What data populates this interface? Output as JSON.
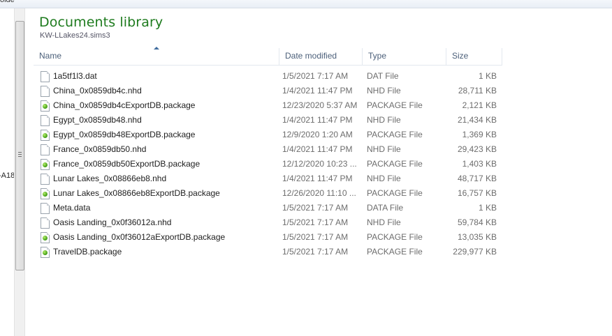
{
  "window": {
    "top_bar_text": "olde"
  },
  "left_pane": {
    "truncated_label": "-A18"
  },
  "library": {
    "title": "Documents library",
    "subtitle": "KW-LLakes24.sims3"
  },
  "columns": {
    "name": "Name",
    "date_modified": "Date modified",
    "type": "Type",
    "size": "Size"
  },
  "files": [
    {
      "name": "1a5tf1l3.dat",
      "date": "1/5/2021 7:17 AM",
      "type": "DAT File",
      "size": "1 KB",
      "icon": "file-icon"
    },
    {
      "name": "China_0x0859db4c.nhd",
      "date": "1/4/2021 11:47 PM",
      "type": "NHD File",
      "size": "28,711 KB",
      "icon": "file-icon"
    },
    {
      "name": "China_0x0859db4cExportDB.package",
      "date": "12/23/2020 5:37 AM",
      "type": "PACKAGE File",
      "size": "2,121 KB",
      "icon": "package-icon"
    },
    {
      "name": "Egypt_0x0859db48.nhd",
      "date": "1/4/2021 11:47 PM",
      "type": "NHD File",
      "size": "21,434 KB",
      "icon": "file-icon"
    },
    {
      "name": "Egypt_0x0859db48ExportDB.package",
      "date": "12/9/2020 1:20 AM",
      "type": "PACKAGE File",
      "size": "1,369 KB",
      "icon": "package-icon"
    },
    {
      "name": "France_0x0859db50.nhd",
      "date": "1/4/2021 11:47 PM",
      "type": "NHD File",
      "size": "29,423 KB",
      "icon": "file-icon"
    },
    {
      "name": "France_0x0859db50ExportDB.package",
      "date": "12/12/2020 10:23 ...",
      "type": "PACKAGE File",
      "size": "1,403 KB",
      "icon": "package-icon"
    },
    {
      "name": "Lunar Lakes_0x08866eb8.nhd",
      "date": "1/4/2021 11:47 PM",
      "type": "NHD File",
      "size": "48,717 KB",
      "icon": "file-icon"
    },
    {
      "name": "Lunar Lakes_0x08866eb8ExportDB.package",
      "date": "12/26/2020 11:10 ...",
      "type": "PACKAGE File",
      "size": "16,757 KB",
      "icon": "package-icon"
    },
    {
      "name": "Meta.data",
      "date": "1/5/2021 7:17 AM",
      "type": "DATA File",
      "size": "1 KB",
      "icon": "file-icon"
    },
    {
      "name": "Oasis Landing_0x0f36012a.nhd",
      "date": "1/5/2021 7:17 AM",
      "type": "NHD File",
      "size": "59,784 KB",
      "icon": "file-icon"
    },
    {
      "name": "Oasis Landing_0x0f36012aExportDB.package",
      "date": "1/5/2021 7:17 AM",
      "type": "PACKAGE File",
      "size": "13,035 KB",
      "icon": "package-icon"
    },
    {
      "name": "TravelDB.package",
      "date": "1/5/2021 7:17 AM",
      "type": "PACKAGE File",
      "size": "229,977 KB",
      "icon": "package-icon"
    }
  ]
}
